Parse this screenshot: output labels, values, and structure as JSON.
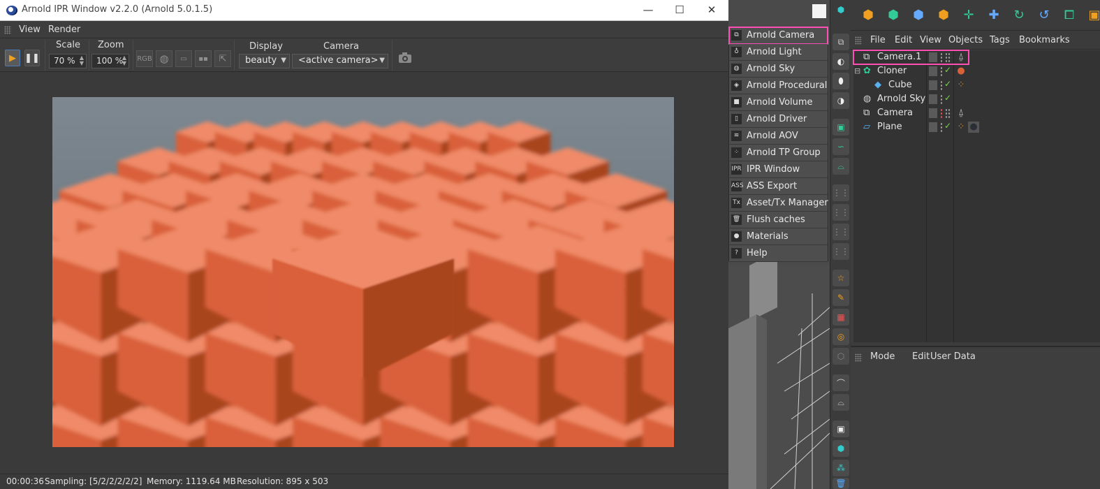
{
  "ipr_window": {
    "title": "Arnold IPR Window v2.2.0 (Arnold 5.0.1.5)",
    "window_buttons": [
      "—",
      "☐",
      "✕"
    ],
    "menu": [
      "View",
      "Render"
    ],
    "toolbar": {
      "scale_label": "Scale",
      "scale_value": "70 %",
      "zoom_label": "Zoom",
      "zoom_value": "100 %",
      "rgb_label": "RGB",
      "display_label": "Display",
      "display_value": "beauty",
      "camera_label": "Camera",
      "camera_value": "<active camera>"
    },
    "status": {
      "time": "00:00:36",
      "sampling": "Sampling: [5/2/2/2/2/2]",
      "memory": "Memory: 1119.64 MB",
      "resolution": "Resolution: 895 x 503"
    }
  },
  "arnold_menu": {
    "items": [
      {
        "label": "Arnold Camera",
        "icon": "camera-icon",
        "glyph": "⧉"
      },
      {
        "label": "Arnold Light",
        "icon": "bulb-icon",
        "glyph": "♁"
      },
      {
        "label": "Arnold Sky",
        "icon": "sky-icon",
        "glyph": "◍"
      },
      {
        "label": "Arnold Procedural",
        "icon": "cube-wire-icon",
        "glyph": "◈"
      },
      {
        "label": "Arnold Volume",
        "icon": "volume-icon",
        "glyph": "■"
      },
      {
        "label": "Arnold Driver",
        "icon": "file-icon",
        "glyph": "▯"
      },
      {
        "label": "Arnold AOV",
        "icon": "layers-icon",
        "glyph": "≋"
      },
      {
        "label": "Arnold TP Group",
        "icon": "particles-icon",
        "glyph": "⁘"
      },
      {
        "label": "IPR Window",
        "icon": "ipr-icon",
        "glyph": "IPR"
      },
      {
        "label": "ASS Export",
        "icon": "ass-icon",
        "glyph": "ASS"
      },
      {
        "label": "Asset/Tx Manager",
        "icon": "tx-icon",
        "glyph": "Tx"
      },
      {
        "label": "Flush caches",
        "icon": "trash-icon",
        "glyph": "🗑"
      },
      {
        "label": "Materials",
        "icon": "sphere-icon",
        "glyph": "●"
      },
      {
        "label": "Help",
        "icon": "help-icon",
        "glyph": "?"
      }
    ]
  },
  "object_manager": {
    "menu": [
      "File",
      "Edit",
      "View",
      "Objects",
      "Tags",
      "Bookmarks"
    ],
    "objects": [
      {
        "name": "Camera.1",
        "icon": "camera-icon"
      },
      {
        "name": "Cloner",
        "icon": "cloner-icon"
      },
      {
        "name": "Cube",
        "icon": "cube-icon"
      },
      {
        "name": "Arnold Sky",
        "icon": "sky-icon"
      },
      {
        "name": "Camera",
        "icon": "camera-icon"
      },
      {
        "name": "Plane",
        "icon": "plane-icon"
      }
    ]
  },
  "attribute_manager": {
    "menu": [
      "Mode",
      "Edit",
      "User Data"
    ]
  },
  "colors": {
    "highlight": "#ff4fb4",
    "accent_orange": "#f0a020",
    "accent_green": "#7ed25c",
    "cube_orange": "#d9613a"
  }
}
